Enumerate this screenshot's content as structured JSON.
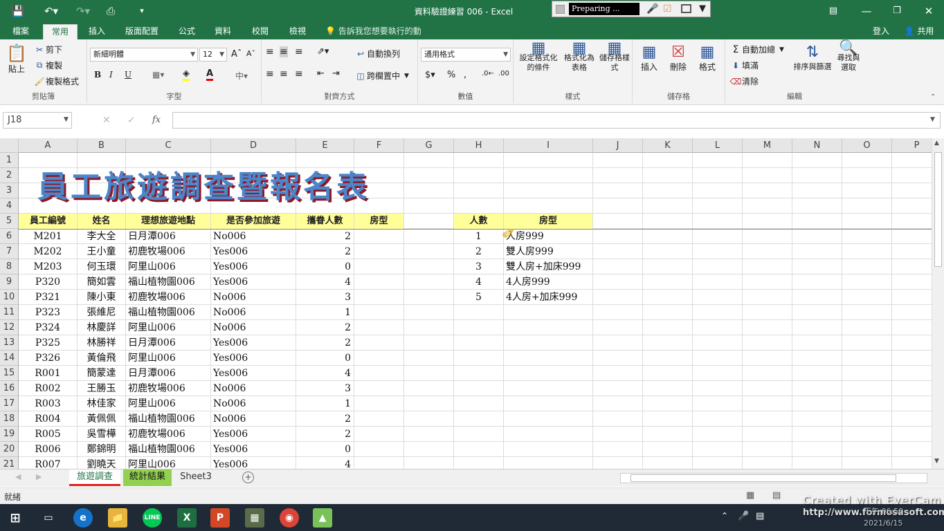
{
  "window": {
    "title": "資料驗證練習 006 - Excel"
  },
  "recorder": {
    "status": "Preparing ..."
  },
  "tabs": [
    "檔案",
    "常用",
    "插入",
    "版面配置",
    "公式",
    "資料",
    "校閱",
    "檢視"
  ],
  "tellme": "告訴我您想要執行的動作...",
  "account": {
    "login": "登入",
    "share": "共用"
  },
  "ribbon": {
    "clipboard": {
      "paste": "貼上",
      "cut": "剪下",
      "copy": "複製",
      "format_painter": "複製格式",
      "label": "剪貼簿"
    },
    "font": {
      "name": "新細明體",
      "size": "12",
      "label": "字型",
      "bold": "B",
      "italic": "I",
      "underline": "U"
    },
    "alignment": {
      "wrap": "自動換列",
      "merge": "跨欄置中",
      "label": "對齊方式"
    },
    "number": {
      "format": "通用格式",
      "label": "數值"
    },
    "styles": {
      "conditional": "設定格式化的條件",
      "table": "格式化為表格",
      "cell": "儲存格樣式",
      "label": "樣式"
    },
    "cells": {
      "insert": "插入",
      "delete": "刪除",
      "format": "格式",
      "label": "儲存格"
    },
    "editing": {
      "autosum": "自動加總",
      "fill": "填滿",
      "clear": "清除",
      "sort": "排序與篩選",
      "find": "尋找與選取",
      "label": "編輯"
    }
  },
  "formula_bar": {
    "name_box": "J18",
    "formula": ""
  },
  "columns": [
    "A",
    "B",
    "C",
    "D",
    "E",
    "F",
    "G",
    "H",
    "I",
    "J",
    "K",
    "L",
    "M",
    "N",
    "O",
    "P"
  ],
  "rows": [
    "1",
    "2",
    "3",
    "4",
    "5",
    "6",
    "7",
    "8",
    "9",
    "10",
    "11",
    "12",
    "13",
    "14",
    "15",
    "16",
    "17",
    "18",
    "19",
    "20",
    "21"
  ],
  "sheet_title": "員工旅遊調查暨報名表",
  "table_headers": [
    "員工編號",
    "姓名",
    "理想旅遊地點",
    "是否參加旅遊",
    "攜眷人數",
    "房型"
  ],
  "employees": [
    [
      "M201",
      "李大全",
      "日月潭006",
      "No006",
      "2"
    ],
    [
      "M202",
      "王小童",
      "初鹿牧場006",
      "Yes006",
      "2"
    ],
    [
      "M203",
      "何玉環",
      "阿里山006",
      "Yes006",
      "0"
    ],
    [
      "P320",
      "簡如雲",
      "福山植物園006",
      "Yes006",
      "4"
    ],
    [
      "P321",
      "陳小東",
      "初鹿牧場006",
      "No006",
      "3"
    ],
    [
      "P323",
      "張維尼",
      "福山植物園006",
      "No006",
      "1"
    ],
    [
      "P324",
      "林慶詳",
      "阿里山006",
      "No006",
      "2"
    ],
    [
      "P325",
      "林勝祥",
      "日月潭006",
      "Yes006",
      "2"
    ],
    [
      "P326",
      "黃倫飛",
      "阿里山006",
      "Yes006",
      "0"
    ],
    [
      "R001",
      "簡蒙達",
      "日月潭006",
      "Yes006",
      "4"
    ],
    [
      "R002",
      "王勝玉",
      "初鹿牧場006",
      "No006",
      "3"
    ],
    [
      "R003",
      "林佳家",
      "阿里山006",
      "No006",
      "1"
    ],
    [
      "R004",
      "黃佩佩",
      "福山植物園006",
      "No006",
      "2"
    ],
    [
      "R005",
      "吳雪樺",
      "初鹿牧場006",
      "Yes006",
      "2"
    ],
    [
      "R006",
      "鄭錦明",
      "福山植物園006",
      "Yes006",
      "0"
    ],
    [
      "R007",
      "劉曉天",
      "阿里山006",
      "Yes006",
      "4"
    ]
  ],
  "lookup_headers": [
    "人數",
    "房型"
  ],
  "lookup": [
    [
      "1",
      "人房999"
    ],
    [
      "2",
      "雙人房999"
    ],
    [
      "3",
      "雙人房+加床999"
    ],
    [
      "4",
      "4人房999"
    ],
    [
      "5",
      "4人房+加床999"
    ]
  ],
  "sheets": [
    "旅遊調查",
    "統計結果",
    "Sheet3"
  ],
  "status": {
    "ready": "就緒"
  },
  "watermark": {
    "line1": "Created with EverCam",
    "line2": "http://www.formosasoft.com",
    "time": "下午 06:50",
    "date": "2021/6/15"
  },
  "colors": {
    "excel_green": "#217346",
    "header_fill": "#ffff99",
    "title_blue": "#4a86c9",
    "title_shadow": "#8b1a2b"
  }
}
